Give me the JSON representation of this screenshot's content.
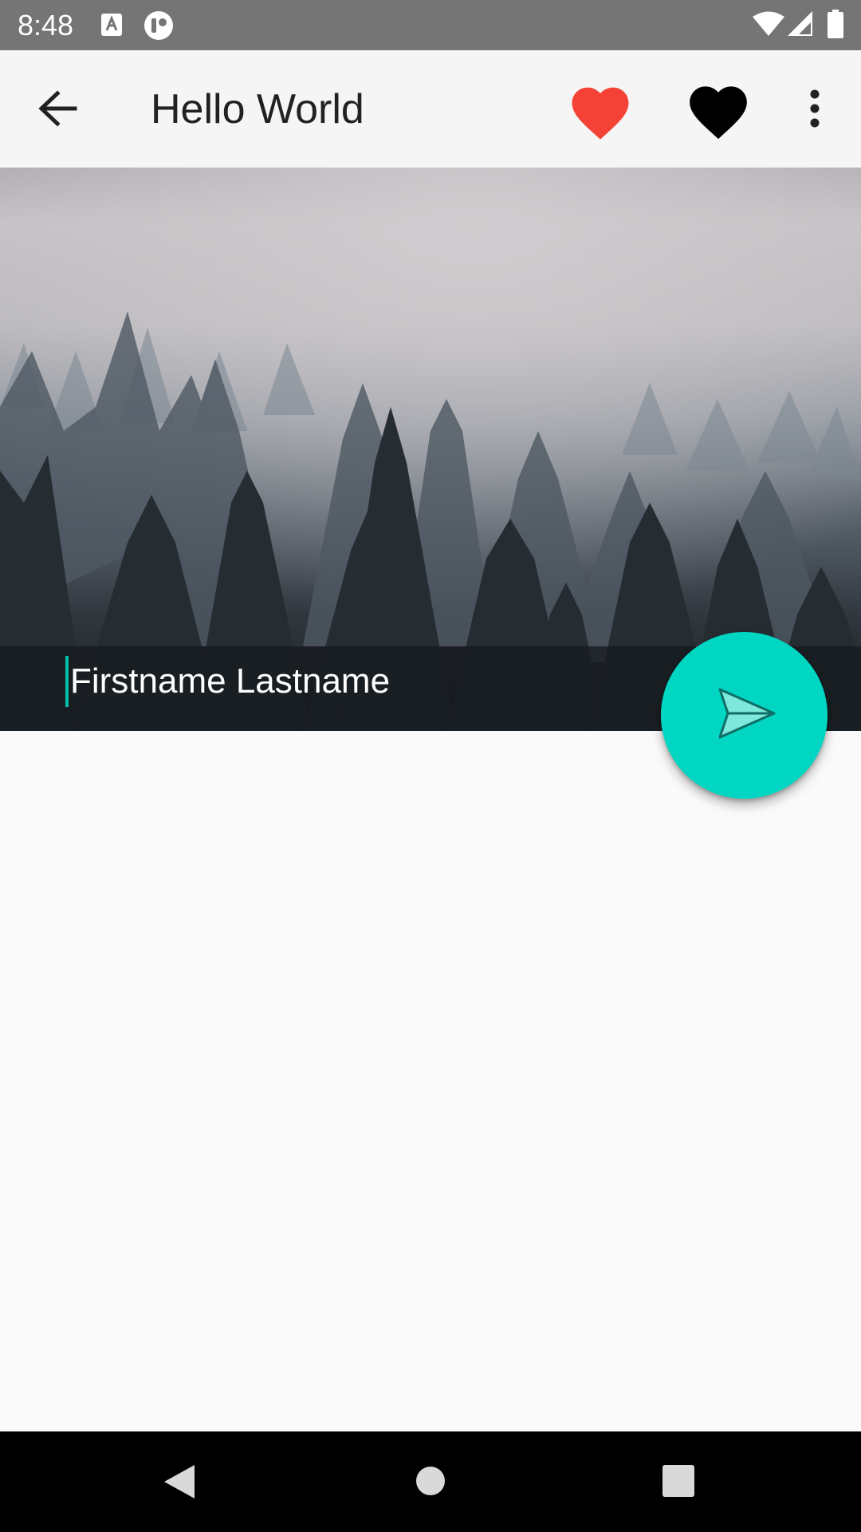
{
  "status_bar": {
    "time": "8:48",
    "icons": [
      "text-notification-icon",
      "app-notification-icon",
      "wifi-icon",
      "cellular-signal-icon",
      "battery-icon"
    ]
  },
  "app_bar": {
    "title": "Hello World",
    "back_icon": "arrow-back-icon",
    "favorite_red_icon": "heart-icon",
    "favorite_black_icon": "heart-icon",
    "overflow_icon": "more-vert-icon",
    "colors": {
      "red_heart": "#f44336",
      "black_heart": "#000000",
      "background": "#f5f5f5"
    }
  },
  "hero": {
    "image_subject": "misty pine forest",
    "name_input_value": "Firstname Lastname"
  },
  "fab": {
    "icon": "send-icon",
    "color": "#00d6c2"
  },
  "nav_bar": {
    "icons": [
      "back-triangle-icon",
      "home-circle-icon",
      "recents-square-icon"
    ]
  }
}
